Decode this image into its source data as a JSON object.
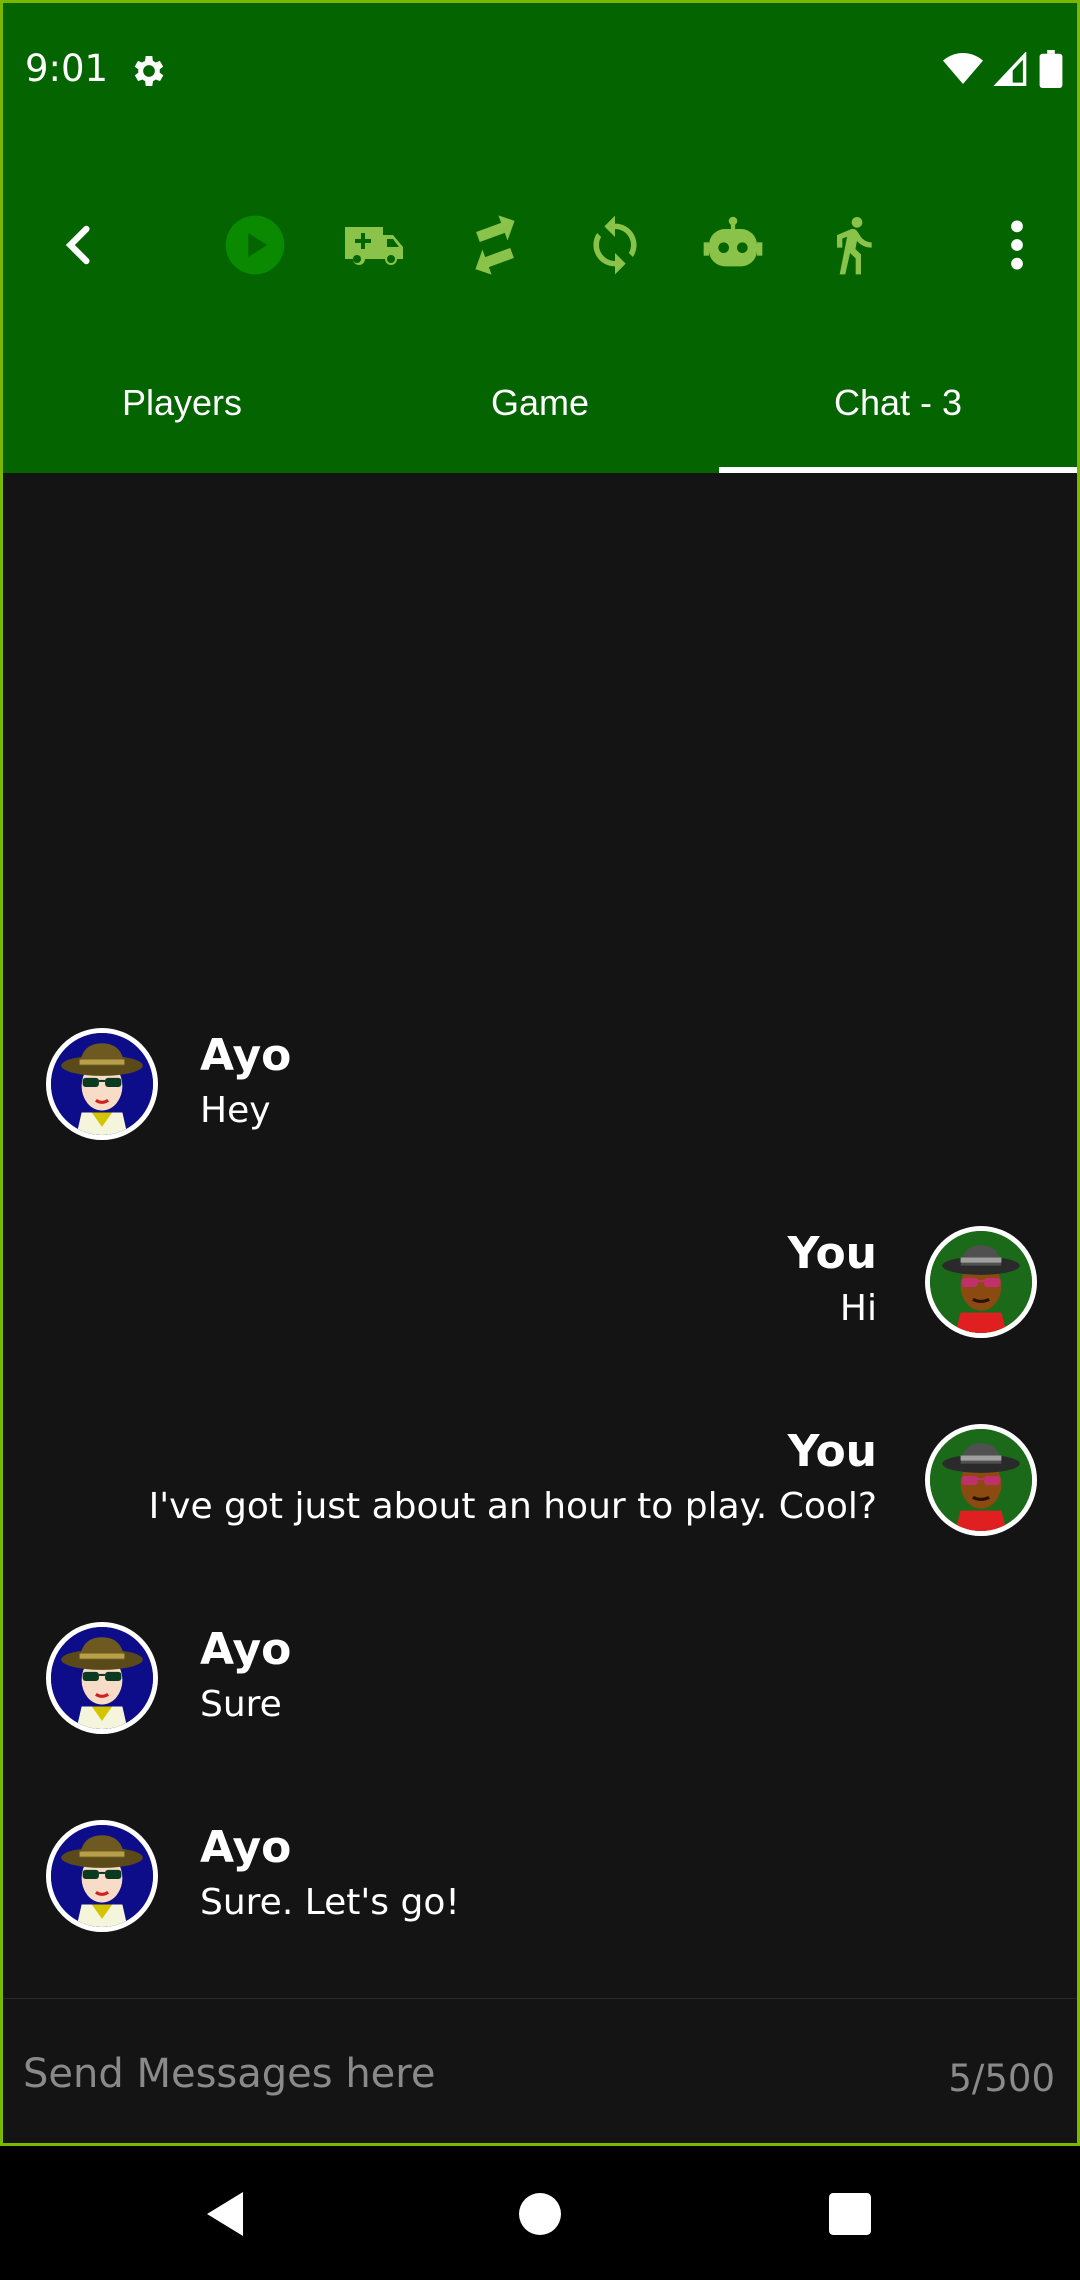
{
  "status_bar": {
    "time": "9:01"
  },
  "toolbar": {
    "icons": [
      "back-arrow-icon",
      "play-icon",
      "ambulance-icon",
      "swap-icon",
      "refresh-icon",
      "robot-icon",
      "walk-icon",
      "more-vert-icon"
    ]
  },
  "tabs": [
    {
      "label": "Players",
      "active": false
    },
    {
      "label": "Game",
      "active": false
    },
    {
      "label": "Chat - 3",
      "active": true
    }
  ],
  "messages": [
    {
      "sender": "Ayo",
      "text": "Hey",
      "side": "left"
    },
    {
      "sender": "You",
      "text": "Hi",
      "side": "right"
    },
    {
      "sender": "You",
      "text": "I've got just about an hour to play. Cool?",
      "side": "right"
    },
    {
      "sender": "Ayo",
      "text": "Sure",
      "side": "left"
    },
    {
      "sender": "Ayo",
      "text": "Sure. Let's go!",
      "side": "left"
    }
  ],
  "composer": {
    "placeholder": "Send Messages here",
    "counter": "5/500"
  },
  "colors": {
    "header_green": "#036400",
    "icon_green": "#8bc34a",
    "play_green": "#0a7a00",
    "frame_border": "#7ab800",
    "background": "#141414"
  }
}
